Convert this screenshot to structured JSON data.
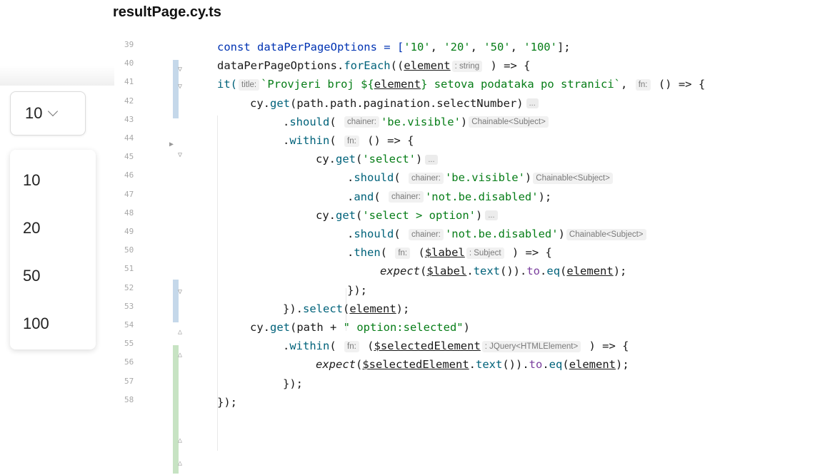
{
  "file_title": "resultPage.cy.ts",
  "dropdown": {
    "selected": "10",
    "options": [
      "10",
      "20",
      "50",
      "100"
    ]
  },
  "line_numbers": [
    "39",
    "40",
    "41",
    "42",
    "43",
    "44",
    "45",
    "46",
    "47",
    "48",
    "49",
    "50",
    "51",
    "52",
    "53",
    "54",
    "55",
    "56",
    "57",
    "58"
  ],
  "code": {
    "l39": [
      "const dataPerPageOptions = [",
      "'10'",
      ", ",
      "'20'",
      ", ",
      "'50'",
      ", ",
      "'100'",
      "];"
    ],
    "l40": {
      "a": "dataPerPageOptions.",
      "b": "forEach",
      "c": "((",
      "d": "element",
      "hint": ": string",
      "e": " ) => {"
    },
    "l41": {
      "a": "it(",
      "hint": "title:",
      "s": "`Provjeri broj ${",
      "v": "element",
      "s2": "} setova podataka po stranici`",
      "b": ", ",
      "hint2": "fn:",
      "c": " () => {"
    },
    "l42": {
      "a": "cy.",
      "b": "get",
      "c": "(path.path.pagination.selectNumber)",
      "dots": "..."
    },
    "l43": {
      "a": ".",
      "b": "should",
      "c": "( ",
      "hint": "chainer:",
      "s": "'be.visible'",
      "d": ")",
      "hint2": "Chainable<Subject>"
    },
    "l44": {
      "a": ".",
      "b": "within",
      "c": "( ",
      "hint": "fn:",
      "d": " () => {"
    },
    "l45": {
      "a": "cy.",
      "b": "get",
      "c": "(",
      "s": "'select'",
      "d": ")",
      "dots": "..."
    },
    "l46": {
      "a": ".",
      "b": "should",
      "c": "( ",
      "hint": "chainer:",
      "s": "'be.visible'",
      "d": ")",
      "hint2": "Chainable<Subject>"
    },
    "l47": {
      "a": ".",
      "b": "and",
      "c": "( ",
      "hint": "chainer:",
      "s": "'not.be.disabled'",
      "d": ");"
    },
    "l48": {
      "a": "cy.",
      "b": "get",
      "c": "(",
      "s": "'select > option'",
      "d": ")",
      "dots": "..."
    },
    "l49": {
      "a": ".",
      "b": "should",
      "c": "( ",
      "hint": "chainer:",
      "s": "'not.be.disabled'",
      "d": ")",
      "hint2": "Chainable<Subject>"
    },
    "l50": {
      "a": ".",
      "b": "then",
      "c": "( ",
      "hint": "fn:",
      "d": " (",
      "v": "$label",
      "hint2": ": Subject",
      "e": " ) => {"
    },
    "l51": {
      "a": "expect",
      "b": "(",
      "v": "$label",
      "c": ".",
      "m": "text",
      "d": "()).",
      "m2": "to",
      "e": ".",
      "m3": "eq",
      "f": "(",
      "v2": "element",
      "g": ");"
    },
    "l52": "});",
    "l53": {
      "a": "}).",
      "b": "select",
      "c": "(",
      "v": "element",
      "d": ");"
    },
    "l54": {
      "a": "cy.",
      "b": "get",
      "c": "(path + ",
      "s": "\" option:selected\"",
      "d": ")"
    },
    "l55": {
      "a": ".",
      "b": "within",
      "c": "( ",
      "hint": "fn:",
      "d": " (",
      "v": "$selectedElement",
      "hint2": ": JQuery<HTMLElement>",
      "e": " ) => {"
    },
    "l56": {
      "a": "expect",
      "b": "(",
      "v": "$selectedElement",
      "c": ".",
      "m": "text",
      "d": "()).",
      "m2": "to",
      "e": ".",
      "m3": "eq",
      "f": "(",
      "v2": "element",
      "g": ");"
    },
    "l57": "});",
    "l58": "});"
  }
}
